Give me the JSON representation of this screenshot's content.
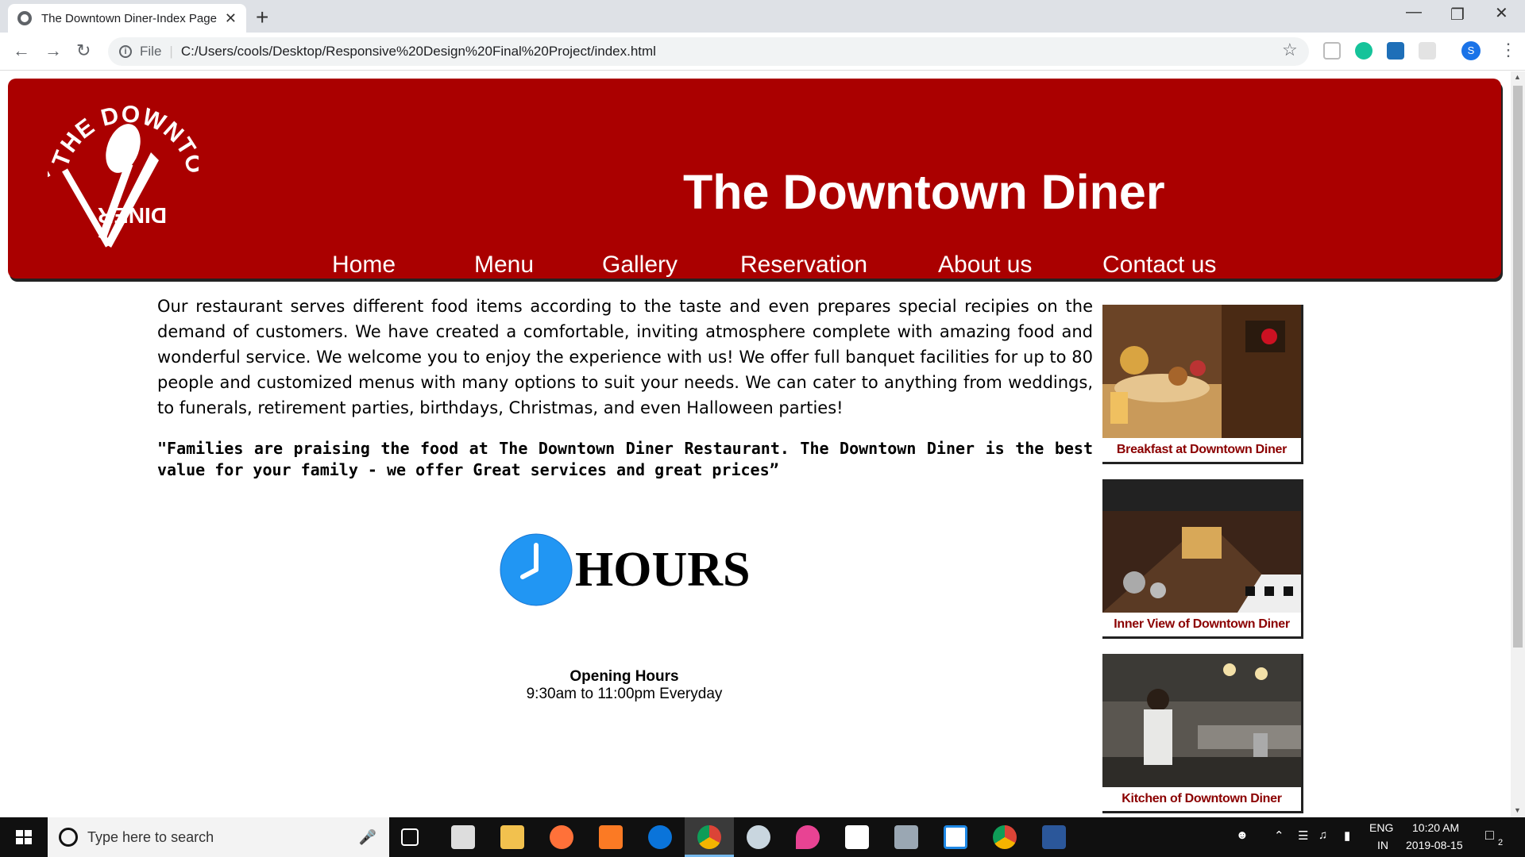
{
  "browser": {
    "tab_title": "The Downtown Diner-Index Page",
    "tab_close": "✕",
    "new_tab": "+",
    "url_scheme": "File",
    "url": "C:/Users/cools/Desktop/Responsive%20Design%20Final%20Project/index.html",
    "profile_initial": "S"
  },
  "header": {
    "site_title": "The Downtown Diner",
    "logo_text": "THE DOWNTOWN DINER"
  },
  "nav": {
    "items": [
      {
        "label": "Home"
      },
      {
        "label": "Menu"
      },
      {
        "label": "Gallery"
      },
      {
        "label": "Reservation"
      },
      {
        "label": "About us"
      },
      {
        "label": "Contact us"
      }
    ]
  },
  "main": {
    "intro": "Our restaurant serves different food items according to the taste and even prepares special recipies on the demand of customers. We have created a comfortable, inviting atmosphere complete with amazing food and wonderful service. We welcome you to enjoy the experience with us! We offer full banquet facilities for up to 80 people and customized menus with many options to suit your needs. We can cater to anything from weddings, to funerals, retirement parties, birthdays, Christmas, and even Halloween parties!",
    "quote": "\"Families are praising the food at The Downtown Diner Restaurant. The Downtown Diner is the best value for your family - we offer Great services and great prices”",
    "hours_title": "HOURS",
    "opening_heading": "Opening Hours",
    "opening_time": "9:30am to 11:00pm Everyday"
  },
  "sidebar": {
    "cards": [
      {
        "caption": "Breakfast at Downtown Diner"
      },
      {
        "caption": "Inner View of Downtown Diner"
      },
      {
        "caption": "Kitchen of Downtown Diner"
      }
    ]
  },
  "taskbar": {
    "search_placeholder": "Type here to search",
    "lang_top": "ENG",
    "lang_bottom": "IN",
    "time": "10:20 AM",
    "date": "2019-08-15",
    "notifications": "2"
  },
  "colors": {
    "header_bg": "#aa0000",
    "caption_text": "#8b0000",
    "clock_blue": "#2196f3"
  }
}
